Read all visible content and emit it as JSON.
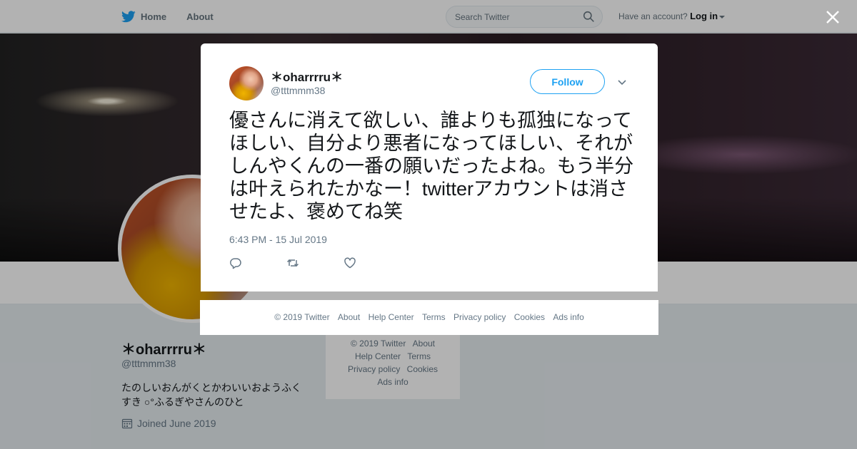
{
  "nav": {
    "home": "Home",
    "about": "About",
    "search_placeholder": "Search Twitter",
    "have_account": "Have an account?",
    "login": "Log in"
  },
  "profile": {
    "name": "＊oharrrru＊",
    "handle": "@tttmmm38",
    "bio": "たのしいおんがくとかわいいおようふくすき ○°ふるぎやさんのひと",
    "joined": "Joined June 2019"
  },
  "side_footer": {
    "copyright": "© 2019 Twitter",
    "about": "About",
    "help": "Help Center",
    "terms": "Terms",
    "privacy": "Privacy policy",
    "cookies": "Cookies",
    "ads": "Ads info"
  },
  "tweet": {
    "name": "＊oharrrru＊",
    "handle": "@tttmmm38",
    "follow": "Follow",
    "text": "優さんに消えて欲しい、誰よりも孤独になってほしい、自分より悪者になってほしい、それがしんやくんの一番の願いだったよね。もう半分は叶えられたかなー！twitterアカウントは消させたよ、褒めてね笑",
    "timestamp": "6:43 PM - 15 Jul 2019"
  },
  "modal_footer": {
    "copyright": "© 2019 Twitter",
    "about": "About",
    "help": "Help Center",
    "terms": "Terms",
    "privacy": "Privacy policy",
    "cookies": "Cookies",
    "ads": "Ads info"
  },
  "colors": {
    "twitter_blue": "#1da1f2",
    "text_secondary": "#657786",
    "background": "#e6ecf0"
  },
  "icons": [
    "twitter-bird-icon",
    "search-icon",
    "caret-down-icon",
    "calendar-icon",
    "chevron-down-icon",
    "reply-icon",
    "retweet-icon",
    "like-icon",
    "close-icon"
  ]
}
